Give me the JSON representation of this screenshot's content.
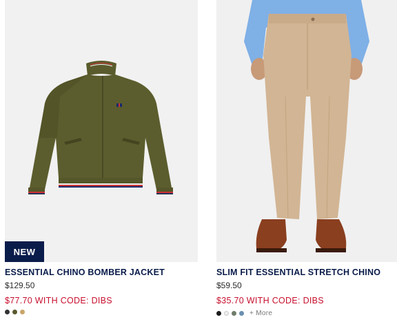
{
  "products": [
    {
      "badge": "NEW",
      "name": "ESSENTIAL CHINO BOMBER JACKET",
      "original_price": "$129.50",
      "promo_price": "$77.70 WITH CODE: DIBS",
      "swatches": [
        "#333333",
        "#5a5a2e",
        "#c9a56a"
      ],
      "image_icon": "jacket-image"
    },
    {
      "name": "SLIM FIT ESSENTIAL STRETCH CHINO",
      "original_price": "$59.50",
      "promo_price": "$35.70 WITH CODE: DIBS",
      "swatches": [
        "#1c1c1c",
        "#eeeeee",
        "#6f7d6a",
        "#6a8fb0"
      ],
      "more_label": "+ More",
      "image_icon": "chino-pants-image"
    }
  ],
  "colors": {
    "navy": "#0a1c4a",
    "promo_red": "#c8102e"
  }
}
